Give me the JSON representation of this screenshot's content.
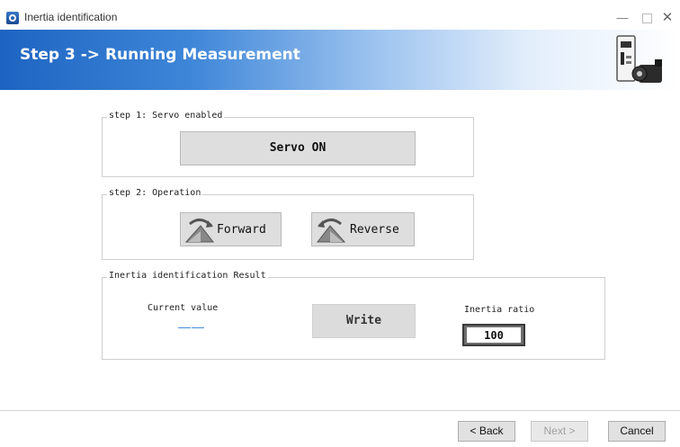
{
  "window": {
    "title": "Inertia identification"
  },
  "banner": {
    "title": "Step 3 -> Running Measurement"
  },
  "step1": {
    "legend": "step 1: Servo enabled",
    "servo_button": "Servo ON"
  },
  "step2": {
    "legend": "step 2: Operation",
    "forward_button": "Forward",
    "reverse_button": "Reverse"
  },
  "result": {
    "legend": "Inertia identification Result",
    "current_value_label": "Current value",
    "current_value": "——",
    "write_button": "Write",
    "inertia_ratio_label": "Inertia ratio",
    "inertia_ratio_value": "100"
  },
  "footer": {
    "back": "< Back",
    "next": "Next >",
    "cancel": "Cancel"
  },
  "colors": {
    "banner_blue": "#1d64c2",
    "current_value_blue": "#3a86d8"
  },
  "icons": [
    "app-logo-icon",
    "servo-drive-icon",
    "forward-rotation-icon",
    "reverse-rotation-icon"
  ]
}
